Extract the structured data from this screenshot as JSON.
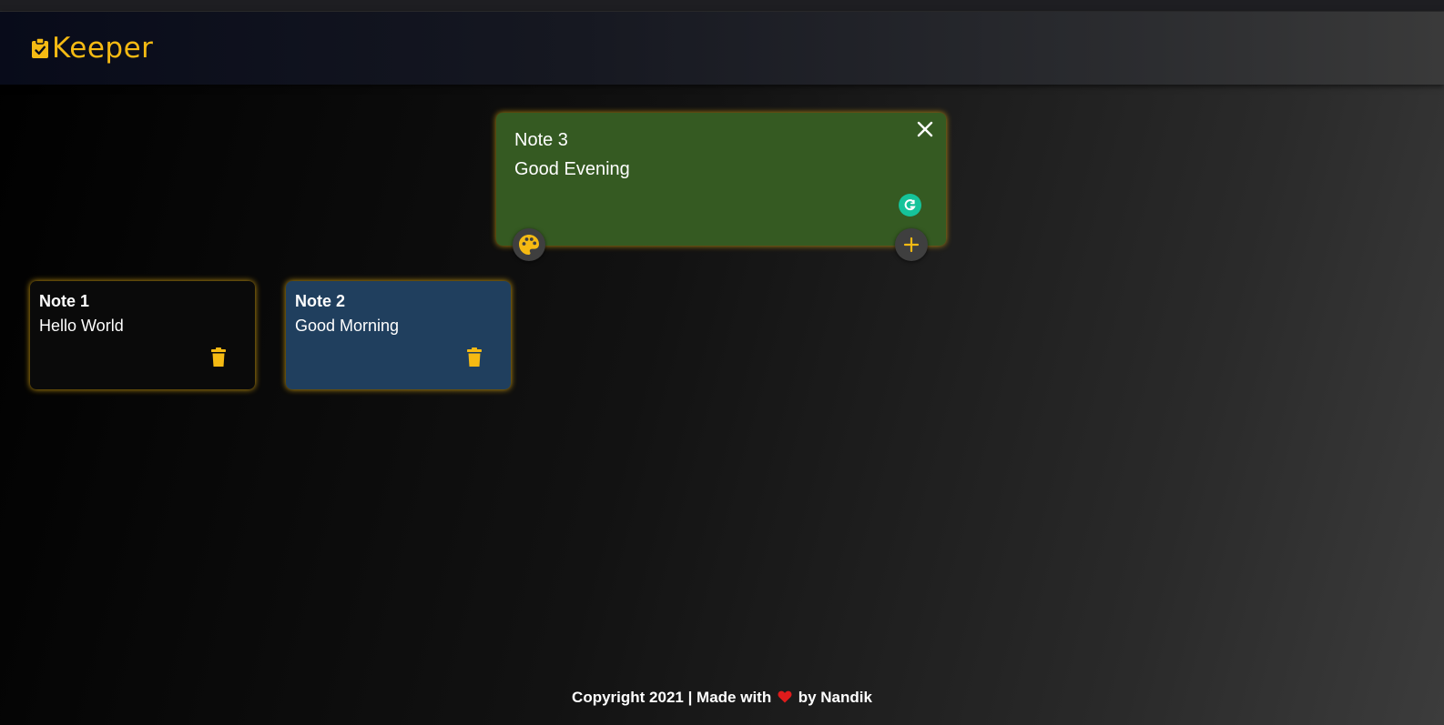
{
  "app": {
    "name": "Keeper",
    "accent_color": "#f5ba13",
    "logo_icon": "clipboard-check-icon"
  },
  "compose": {
    "title": "Note 3",
    "content": "Good Evening",
    "background_color": "#355a22",
    "close_icon": "close-icon",
    "palette_icon": "palette-icon",
    "add_icon": "plus-icon",
    "grammarly_icon": "grammarly-icon"
  },
  "notes": [
    {
      "title": "Note 1",
      "content": "Hello World",
      "background_color": "#0a0a0a",
      "delete_icon": "trash-icon"
    },
    {
      "title": "Note 2",
      "content": "Good Morning",
      "background_color": "#203f5e",
      "delete_icon": "trash-icon"
    }
  ],
  "footer": {
    "text_before": "Copyright 2021 | Made with",
    "heart_icon": "heart-icon",
    "heart_color": "#e01b1b",
    "text_after": "by Nandik"
  }
}
